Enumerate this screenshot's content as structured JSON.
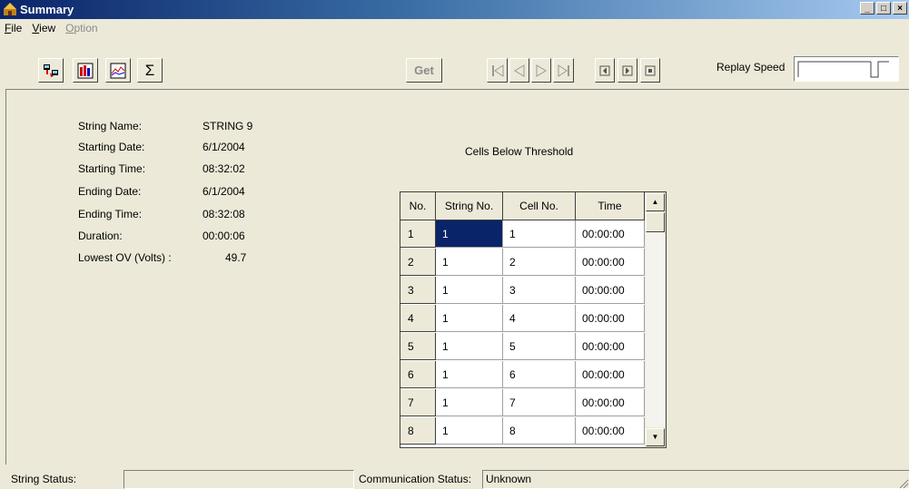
{
  "window": {
    "title": "Summary",
    "min": "_",
    "max": "□",
    "close": "×"
  },
  "menu": [
    {
      "label": "File",
      "accel": "F",
      "rest": "ile"
    },
    {
      "label": "View",
      "accel": "V",
      "rest": "iew"
    },
    {
      "label": "Option",
      "accel": "O",
      "rest": "ption",
      "disabled": true
    }
  ],
  "toolbar": {
    "sigma_label": "Σ",
    "get_label": "Get",
    "replay_label": "Replay Speed",
    "replay_speed_fraction": 1.0
  },
  "info": {
    "string_name_label": "String Name:",
    "string_name": "STRING 9",
    "start_date_label": "Starting Date:",
    "start_date": "6/1/2004",
    "start_time_label": "Starting Time:",
    "start_time": "08:32:02",
    "end_date_label": "Ending Date:",
    "end_date": "6/1/2004",
    "end_time_label": "Ending Time:",
    "end_time": "08:32:08",
    "duration_label": "Duration:",
    "duration": "00:00:06",
    "lowest_ov_label": "Lowest OV (Volts) :",
    "lowest_ov": "49.7"
  },
  "grid": {
    "title": "Cells Below Threshold",
    "columns": [
      "No.",
      "String No.",
      "Cell No.",
      "Time"
    ],
    "rows": [
      [
        "1",
        "1",
        "1",
        "00:00:00"
      ],
      [
        "2",
        "1",
        "2",
        "00:00:00"
      ],
      [
        "3",
        "1",
        "3",
        "00:00:00"
      ],
      [
        "4",
        "1",
        "4",
        "00:00:00"
      ],
      [
        "5",
        "1",
        "5",
        "00:00:00"
      ],
      [
        "6",
        "1",
        "6",
        "00:00:00"
      ],
      [
        "7",
        "1",
        "7",
        "00:00:00"
      ],
      [
        "8",
        "1",
        "8",
        "00:00:00"
      ]
    ]
  },
  "status": {
    "string_status_label": "String Status:",
    "string_status_value": "",
    "comm_status_label": "Communication Status:",
    "comm_status_value": "Unknown"
  },
  "colors": {
    "selection": "#0a246a",
    "face": "#ece9d8"
  }
}
